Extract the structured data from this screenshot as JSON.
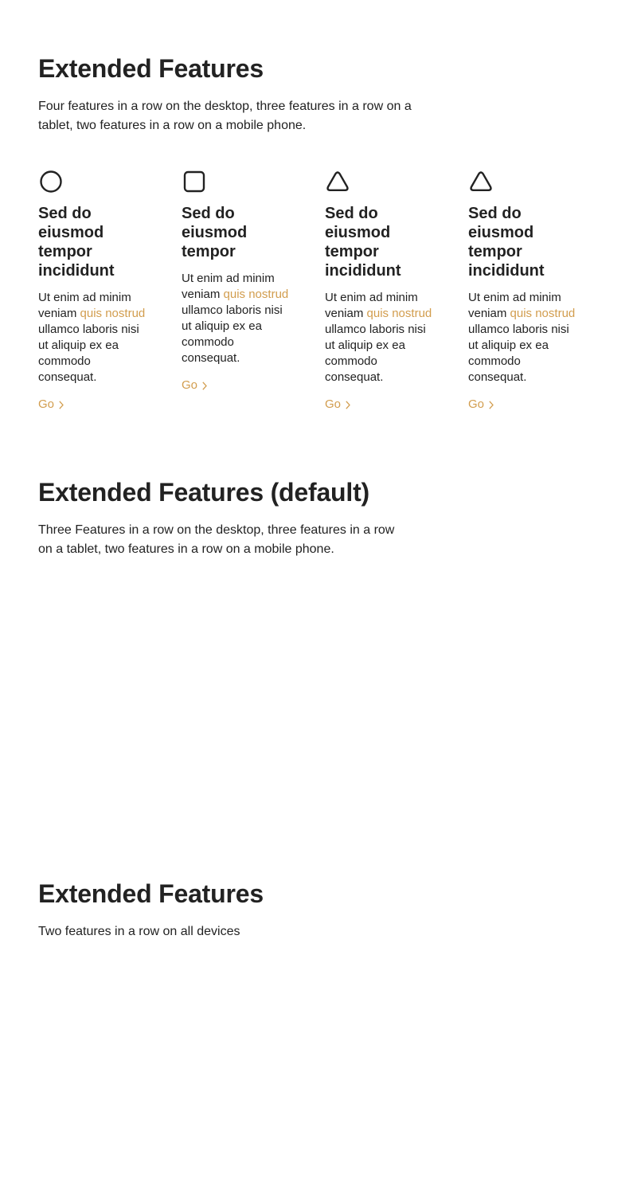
{
  "colors": {
    "accent": "#d29d4e",
    "text": "#222222",
    "background": "#ffffff"
  },
  "sections": [
    {
      "title": "Extended Features",
      "lead": "Four features in a row on the desktop, three features in a row on a tablet, two features in a row on a mobile phone.",
      "features": [
        {
          "icon": "circle-icon",
          "title": "Sed do eiusmod tempor incididunt",
          "text_before": "Ut enim ad minim veniam ",
          "link": "quis nostrud",
          "text_after": " ullamco laboris nisi ut aliquip ex ea commodo consequat.",
          "cta": "Go"
        },
        {
          "icon": "square-icon",
          "title": "Sed do eiusmod tempor",
          "text_before": "Ut enim ad minim veniam ",
          "link": "quis nostrud",
          "text_after": " ullamco laboris nisi ut aliquip ex ea commodo consequat.",
          "cta": "Go"
        },
        {
          "icon": "triangle-icon",
          "title": "Sed do eiusmod tempor incididunt",
          "text_before": "Ut enim ad minim veniam ",
          "link": "quis nostrud",
          "text_after": " ullamco laboris nisi ut aliquip ex ea commodo consequat.",
          "cta": "Go"
        },
        {
          "icon": "triangle-icon",
          "title": "Sed do eiusmod tempor incididunt",
          "text_before": "Ut enim ad minim veniam ",
          "link": "quis nostrud",
          "text_after": " ullamco laboris nisi ut aliquip ex ea commodo consequat.",
          "cta": "Go"
        }
      ]
    },
    {
      "title": "Extended Features (default)",
      "lead": "Three Features in a row on the desktop, three features in a row on a tablet, two features in a row on a mobile phone."
    },
    {
      "title": "Extended Features",
      "lead": "Two features in a row on all devices"
    }
  ]
}
